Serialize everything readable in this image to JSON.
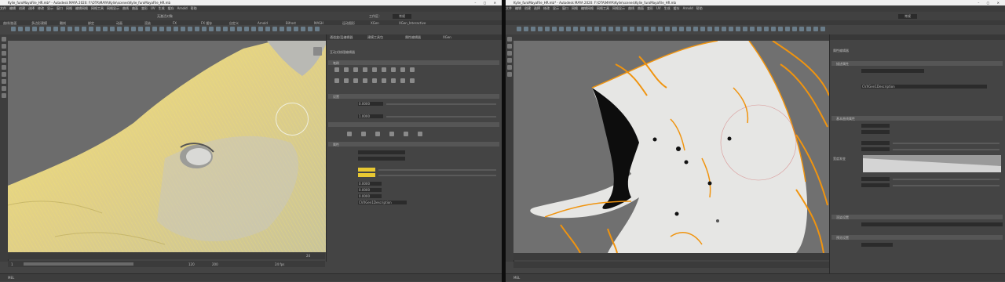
{
  "left_window": {
    "title": "Kylie_furoMayaFile_HR.mb* - Autodesk MAYA 2020: F:\\OTA\\MAYA\\Kylie\\scenes\\Kylie_furoMayaFile_HR.mb",
    "menu": [
      "文件",
      "编辑",
      "创建",
      "选择",
      "修改",
      "显示",
      "窗口",
      "网格",
      "编辑网格",
      "网格工具",
      "网格显示",
      "曲线",
      "曲面",
      "变形",
      "UV",
      "生成",
      "缓存",
      "Arnold",
      "帮助"
    ],
    "workspace_label": "工作区：",
    "workspace_value": "常规",
    "symmetry_label": "无激活对象",
    "shelf_tabs": [
      "曲线/曲面",
      "多边形建模",
      "雕刻",
      "绑定",
      "动画",
      "渲染",
      "FX",
      "FX 缓存",
      "自定义",
      "Arnold",
      "Bifrost",
      "MASH",
      "运动图形",
      "XGen",
      "XGen_Interactive"
    ],
    "editor_tabs": [
      "通道盒/层编辑器",
      "建模工具包",
      "属性编辑器",
      "XGen"
    ],
    "panel_title": "互动式梳理编辑器",
    "brush_header": "笔刷",
    "settings_header": "设置",
    "attribute_label": "属性",
    "field_values": [
      "0.0000",
      "1.0000",
      "0.0000",
      "0.0000",
      "0.0000"
    ],
    "preview_name": "CVXGen1Description",
    "timeline_end": "24",
    "range_start": "1",
    "range_end": "120",
    "range_max": "200",
    "fps": "24 fps",
    "cmd_label": "MEL",
    "highlight_color": "#e8c832"
  },
  "right_window": {
    "title": "Kylie_furoMayaFile_HR.mb* - Autodesk MAYA 2020: F:\\OTA\\MAYA\\Kylie\\scenes\\Kylie_furoMayaFile_HR.mb",
    "menu": [
      "文件",
      "编辑",
      "创建",
      "选择",
      "修改",
      "显示",
      "窗口",
      "网格",
      "编辑网格",
      "网格工具",
      "网格显示",
      "曲线",
      "曲面",
      "变形",
      "UV",
      "生成",
      "缓存",
      "Arnold",
      "帮助"
    ],
    "workspace_value": "常规",
    "panel_title": "属性编辑器",
    "sections": [
      "描述属性",
      "基本曲线属性",
      "渲染设置",
      "预览设置"
    ],
    "description_name": "CVXGen1Description",
    "graph_label": "宽度渐变",
    "cmd_label": "MEL",
    "guide_color": "#f0940f"
  }
}
